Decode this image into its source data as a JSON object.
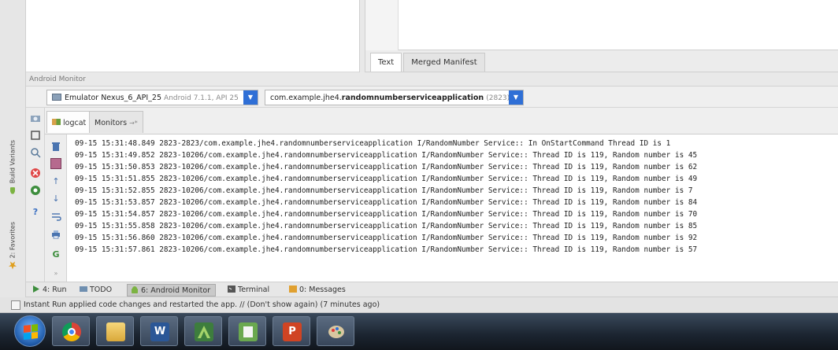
{
  "sidebar": {
    "build_variants_label": "Build Variants",
    "favorites_label": "2: Favorites"
  },
  "editor": {
    "tabs": [
      {
        "label": "Text",
        "active": true
      },
      {
        "label": "Merged Manifest",
        "active": false
      }
    ]
  },
  "monitor": {
    "title": "Android Monitor",
    "device_name": "Emulator Nexus_6_API_25",
    "device_detail": "Android 7.1.1, API 25",
    "process_prefix": "com.example.jhe4.",
    "process_name": "randomnumberserviceapplication",
    "process_pid": "(2823)",
    "tabs": [
      {
        "label": "logcat",
        "active": true
      },
      {
        "label": "Monitors",
        "active": false
      }
    ]
  },
  "logcat": {
    "lines": [
      "09-15 15:31:48.849 2823-2823/com.example.jhe4.randomnumberserviceapplication I/RandomNumber Service:: In OnStartCommand Thread ID is 1",
      "09-15 15:31:49.852 2823-10206/com.example.jhe4.randomnumberserviceapplication I/RandomNumber Service:: Thread ID is 119, Random number is 45",
      "09-15 15:31:50.853 2823-10206/com.example.jhe4.randomnumberserviceapplication I/RandomNumber Service:: Thread ID is 119, Random number is 62",
      "09-15 15:31:51.855 2823-10206/com.example.jhe4.randomnumberserviceapplication I/RandomNumber Service:: Thread ID is 119, Random number is 49",
      "09-15 15:31:52.855 2823-10206/com.example.jhe4.randomnumberserviceapplication I/RandomNumber Service:: Thread ID is 119, Random number is 7",
      "09-15 15:31:53.857 2823-10206/com.example.jhe4.randomnumberserviceapplication I/RandomNumber Service:: Thread ID is 119, Random number is 84",
      "09-15 15:31:54.857 2823-10206/com.example.jhe4.randomnumberserviceapplication I/RandomNumber Service:: Thread ID is 119, Random number is 70",
      "09-15 15:31:55.858 2823-10206/com.example.jhe4.randomnumberserviceapplication I/RandomNumber Service:: Thread ID is 119, Random number is 85",
      "09-15 15:31:56.860 2823-10206/com.example.jhe4.randomnumberserviceapplication I/RandomNumber Service:: Thread ID is 119, Random number is 92",
      "09-15 15:31:57.861 2823-10206/com.example.jhe4.randomnumberserviceapplication I/RandomNumber Service:: Thread ID is 119, Random number is 57"
    ]
  },
  "toolwindows": {
    "run": "4: Run",
    "todo": "TODO",
    "android_monitor": "6: Android Monitor",
    "terminal": "Terminal",
    "messages": "0: Messages"
  },
  "status": {
    "message": "Instant Run applied code changes and restarted the app. // (Don't show again) (7 minutes ago)"
  },
  "taskbar": {
    "word_glyph": "W",
    "powerpoint_glyph": "P"
  },
  "colors": {
    "accent_blue": "#2f6fd6",
    "android_green": "#7cb342"
  }
}
